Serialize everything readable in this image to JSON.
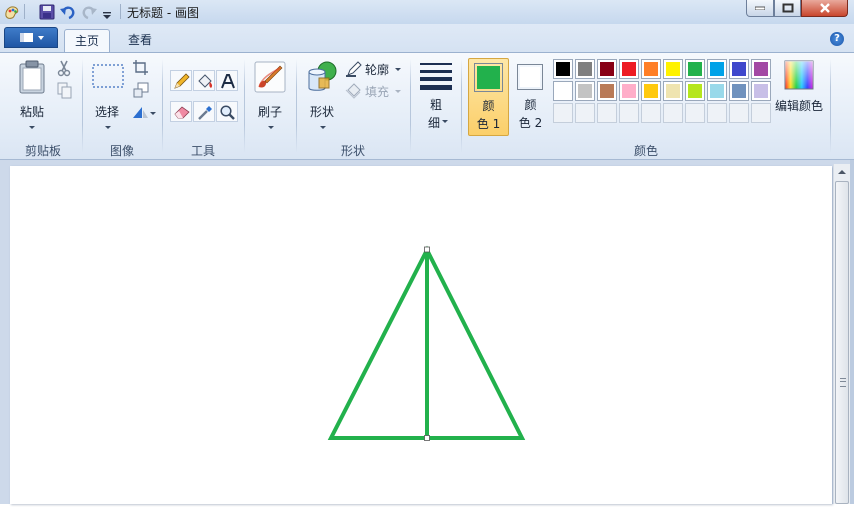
{
  "window": {
    "title": "无标题 - 画图"
  },
  "tabs": [
    {
      "label": "主页",
      "active": true
    },
    {
      "label": "查看",
      "active": false
    }
  ],
  "help_label": "?",
  "groups": {
    "clipboard": {
      "label": "剪贴板",
      "paste_label": "粘贴"
    },
    "image": {
      "label": "图像",
      "select_label": "选择"
    },
    "tools": {
      "label": "工具"
    },
    "brushes": {
      "label": "刷子"
    },
    "shapes": {
      "label": "形状",
      "shapes_label": "形状",
      "outline_label": "轮廓",
      "fill_label": "填充"
    },
    "size": {
      "label_line1": "粗",
      "label_line2": "细"
    },
    "colors": {
      "label": "颜色",
      "color1_line1": "颜",
      "color1_line2": "色 1",
      "color2_line1": "颜",
      "color2_line2": "色 2",
      "edit_label": "编辑颜色",
      "color1_value": "#22b14c",
      "color2_value": "#ffffff",
      "palette_row1": [
        "#000000",
        "#7f7f7f",
        "#880015",
        "#ed1c24",
        "#ff7f27",
        "#fff200",
        "#22b14c",
        "#00a2e8",
        "#3f48cc",
        "#a349a4"
      ],
      "palette_row2": [
        "#ffffff",
        "#c3c3c3",
        "#b97a57",
        "#ffaec9",
        "#ffc90e",
        "#efe4b0",
        "#b5e61d",
        "#99d9ea",
        "#7092be",
        "#c8bfe7"
      ]
    }
  },
  "drawing": {
    "stroke_color": "#22b14c",
    "shape": "triangle-with-median"
  }
}
